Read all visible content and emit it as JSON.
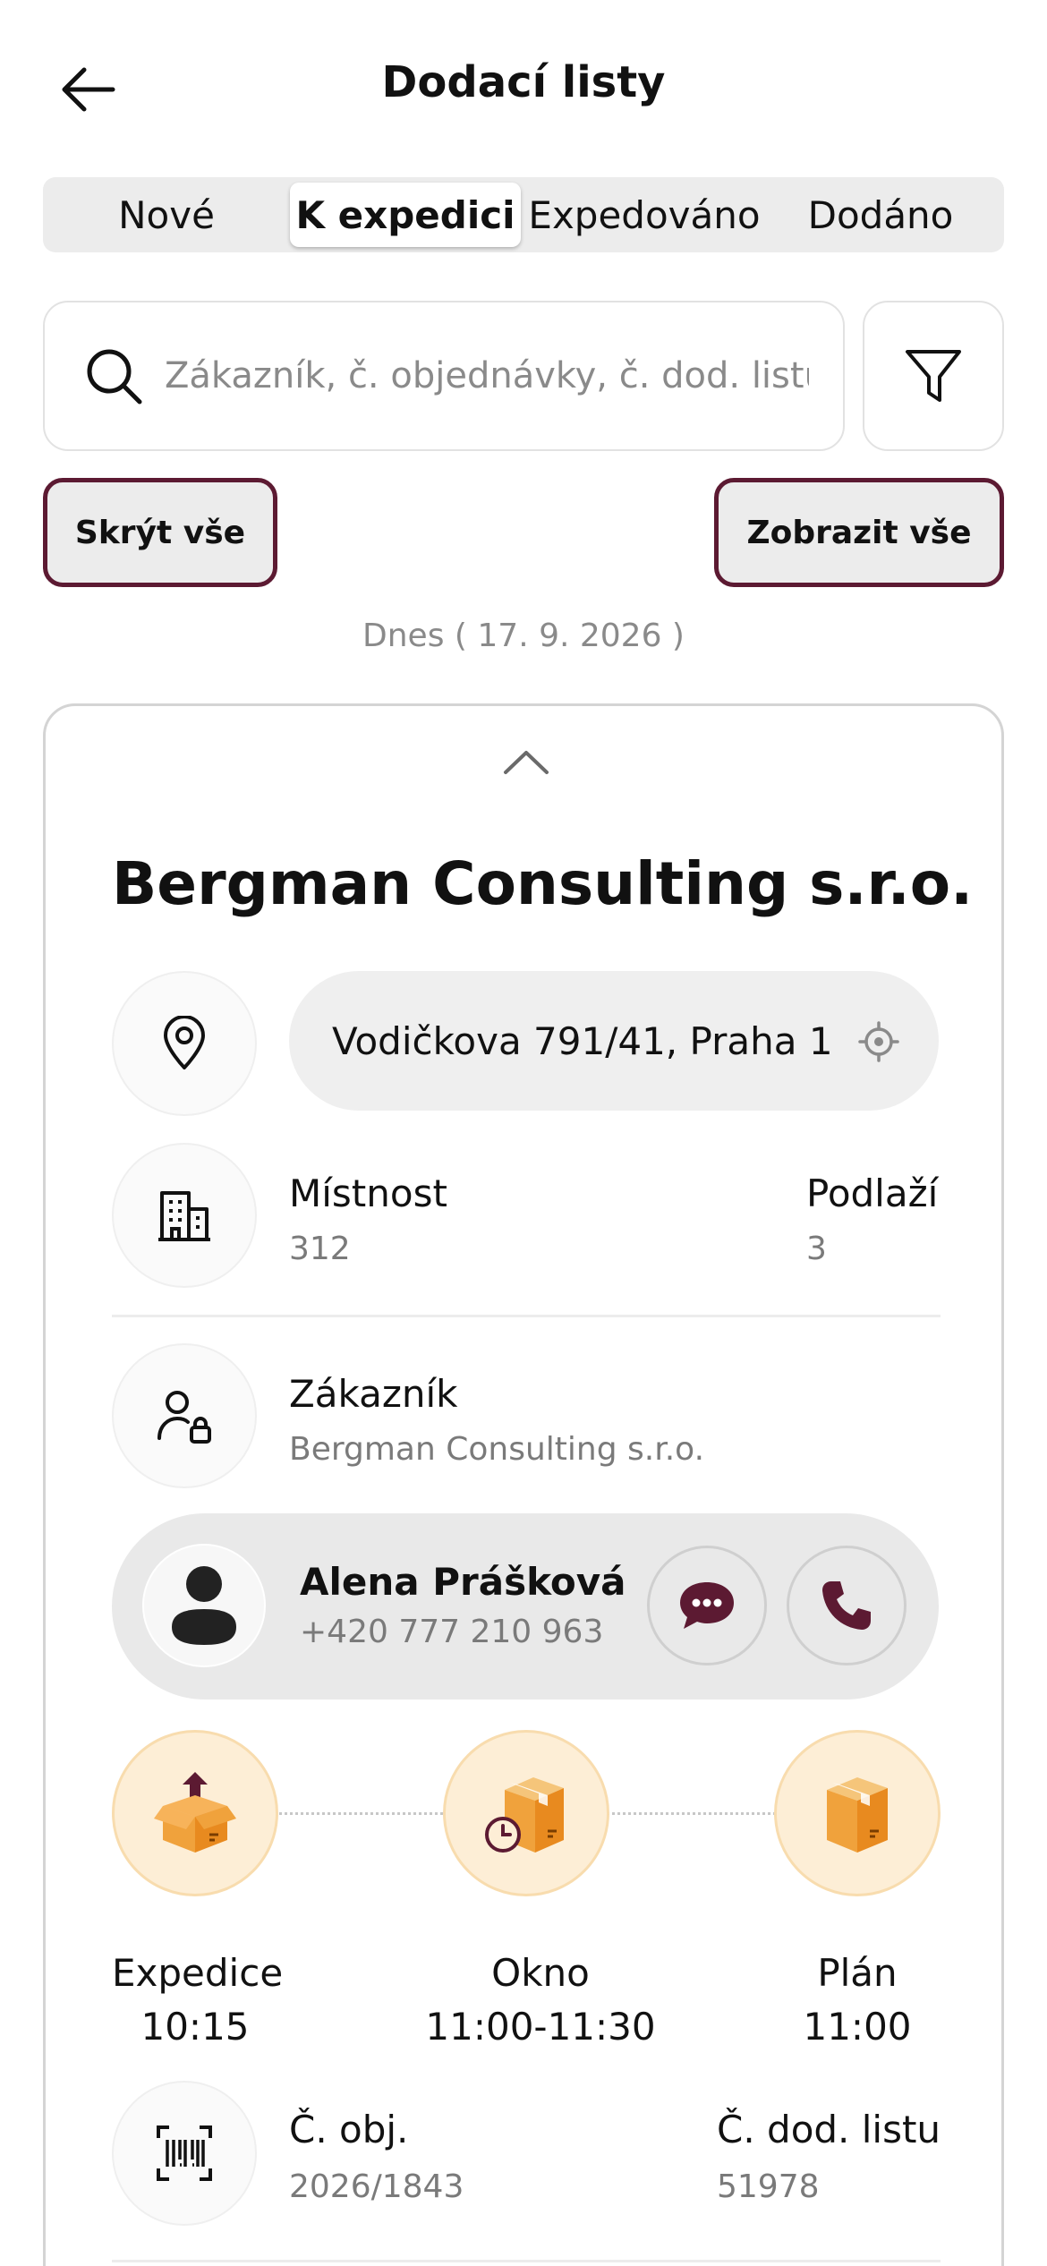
{
  "header": {
    "title": "Dodací listy",
    "back_icon": "arrow-left-icon"
  },
  "tabs": [
    {
      "label": "Nové",
      "active": false
    },
    {
      "label": "K expedici",
      "active": true
    },
    {
      "label": "Expedováno",
      "active": false
    },
    {
      "label": "Dodáno",
      "active": false
    }
  ],
  "search": {
    "placeholder": "Zákazník, č. objednávky, č. dod. listu",
    "value": ""
  },
  "buttons": {
    "hide_all": "Skrýt vše",
    "show_all": "Zobrazit vše"
  },
  "date_label": "Dnes ( 17. 9. 2026 )",
  "card": {
    "company": "Bergman Consulting s.r.o.",
    "address": "Vodičkova 791/41, Praha 1",
    "room": {
      "label": "Místnost",
      "value": "312"
    },
    "floor": {
      "label": "Podlaží",
      "value": "3"
    },
    "customer": {
      "label": "Zákazník",
      "value": "Bergman Consulting s.r.o."
    },
    "contact": {
      "name": "Alena Prášková",
      "phone": "+420 777 210 963"
    },
    "timeline": [
      {
        "label": "Expedice",
        "time": "10:15"
      },
      {
        "label": "Okno",
        "time": "11:00-11:30"
      },
      {
        "label": "Plán",
        "time": "11:00"
      }
    ],
    "order_no": {
      "label": "Č. obj.",
      "value": "2026/1843"
    },
    "delivery_no": {
      "label": "Č. dod. listu",
      "value": "51978"
    }
  },
  "colors": {
    "accent": "#5c1a32",
    "step_bg": "#fdeed6",
    "box": "#e88a1f"
  }
}
